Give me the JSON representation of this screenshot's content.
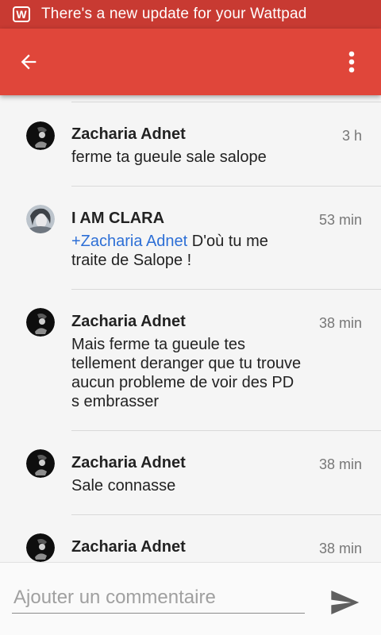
{
  "status_bar": {
    "app_icon": "wattpad-w-icon",
    "notification": "There's a new update for your Wattpad"
  },
  "app_bar": {
    "back_icon": "arrow-left-icon",
    "menu_icon": "more-vert-icon"
  },
  "comments": [
    {
      "author": "Zacharia Adnet",
      "time": "3 h",
      "body": "ferme ta gueule sale salope",
      "avatar": "dark-photo-avatar"
    },
    {
      "author": "I AM CLARA",
      "time": "53 min",
      "mention": "+Zacharia Adnet",
      "body": " D'où tu me traite de Salope !",
      "avatar": "grey-photo-avatar"
    },
    {
      "author": "Zacharia Adnet",
      "time": "38 min",
      "body": "Mais ferme ta gueule tes tellement deranger que tu trouve aucun probleme de voir des PD s embrasser",
      "avatar": "dark-photo-avatar"
    },
    {
      "author": "Zacharia Adnet",
      "time": "38 min",
      "body": "Sale connasse",
      "avatar": "dark-photo-avatar"
    },
    {
      "author": "Zacharia Adnet",
      "time": "38 min",
      "body": "",
      "avatar": "dark-photo-avatar"
    }
  ],
  "composer": {
    "placeholder": "Ajouter un commentaire",
    "value": "",
    "send_icon": "send-icon"
  },
  "colors": {
    "status_bar": "#c83a32",
    "app_bar": "#e0463a",
    "mention_link": "#2d6fd6"
  }
}
